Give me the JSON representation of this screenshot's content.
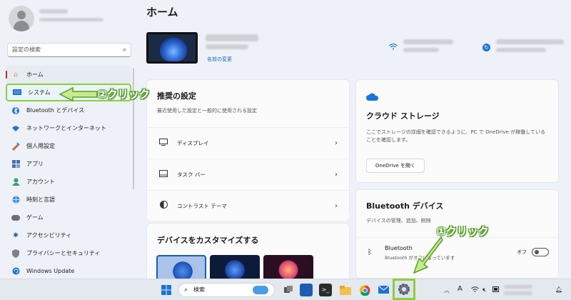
{
  "page": {
    "title": "ホーム"
  },
  "sidebar": {
    "search_placeholder": "設定の検索",
    "items": [
      {
        "label": "ホーム",
        "icon": "home-icon"
      },
      {
        "label": "システム",
        "icon": "display-icon"
      },
      {
        "label": "Bluetooth とデバイス",
        "icon": "bluetooth-icon"
      },
      {
        "label": "ネットワークとインターネット",
        "icon": "wifi-icon"
      },
      {
        "label": "個人用設定",
        "icon": "brush-icon"
      },
      {
        "label": "アプリ",
        "icon": "apps-icon"
      },
      {
        "label": "アカウント",
        "icon": "account-icon"
      },
      {
        "label": "時刻と言語",
        "icon": "globe-icon"
      },
      {
        "label": "ゲーム",
        "icon": "gamepad-icon"
      },
      {
        "label": "アクセシビリティ",
        "icon": "accessibility-icon"
      },
      {
        "label": "プライバシーとセキュリティ",
        "icon": "shield-icon"
      },
      {
        "label": "Windows Update",
        "icon": "update-icon"
      }
    ]
  },
  "device": {
    "rename_link": "名前の変更"
  },
  "recommended": {
    "title": "推奨の設定",
    "subtitle": "最近使用した設定と一般的に使用される設定",
    "rows": [
      {
        "label": "ディスプレイ",
        "icon": "monitor-icon"
      },
      {
        "label": "タスク バー",
        "icon": "taskbar-icon"
      },
      {
        "label": "コントラスト テーマ",
        "icon": "contrast-icon"
      }
    ]
  },
  "customize": {
    "title": "デバイスをカスタマイズする"
  },
  "cloud": {
    "title": "クラウド ストレージ",
    "description": "ここでストレージの詳細を確認できるように、PC で OneDrive が稼働していることを確認します。",
    "button": "OneDrive を開く"
  },
  "bluetooth": {
    "title": "Bluetooth デバイス",
    "subtitle": "デバイスの管理、追加、削除",
    "row_title": "Bluetooth",
    "row_subtitle": "Bluetooth がオフになっています",
    "toggle_label": "オフ"
  },
  "callouts": {
    "step2": "②クリック",
    "step1": "①クリック"
  },
  "taskbar": {
    "search_placeholder": "検索"
  },
  "colors": {
    "accent": "#1a73d9",
    "highlight": "#8fce3a",
    "callout_outline": "#5a9e2c"
  }
}
